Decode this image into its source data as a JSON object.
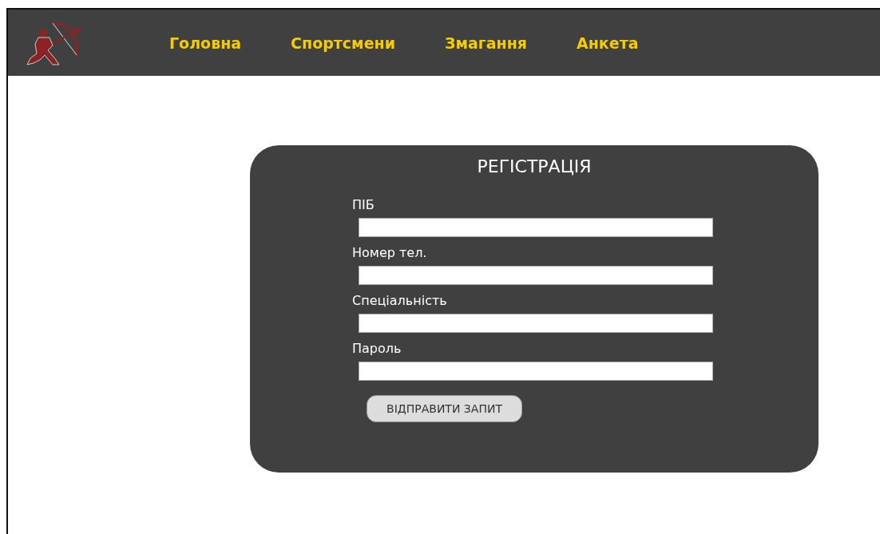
{
  "nav": {
    "items": [
      "Головна",
      "Спортсмени",
      "Змагання",
      "Анкета"
    ]
  },
  "form": {
    "title": "РЕГІСТРАЦІЯ",
    "fields": [
      {
        "label": "ПІБ"
      },
      {
        "label": "Номер тел."
      },
      {
        "label": "Спеціальність"
      },
      {
        "label": "Пароль"
      }
    ],
    "submit": "ВІДПРАВИТИ ЗАПИТ"
  }
}
